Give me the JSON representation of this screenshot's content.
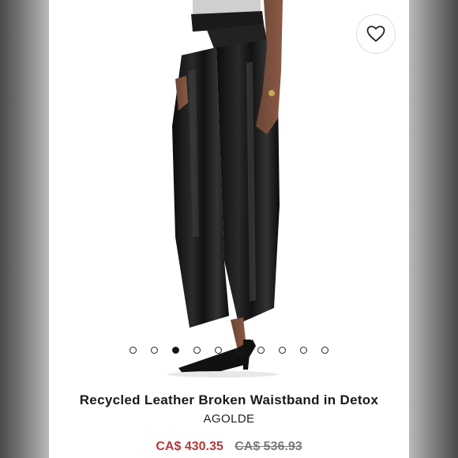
{
  "product": {
    "title": "Recycled Leather Broken Waistband in Detox",
    "brand": "AGOLDE",
    "sale_price": "CA$ 430.35",
    "original_price": "CA$ 536.93",
    "image": "leather-pants-photo"
  },
  "carousel": {
    "count": 10,
    "active_index": 2
  },
  "icons": {
    "favorite": "heart-icon"
  },
  "colors": {
    "sale": "#b23a3a",
    "original": "#7a7a7a",
    "text": "#1a1a1a"
  }
}
